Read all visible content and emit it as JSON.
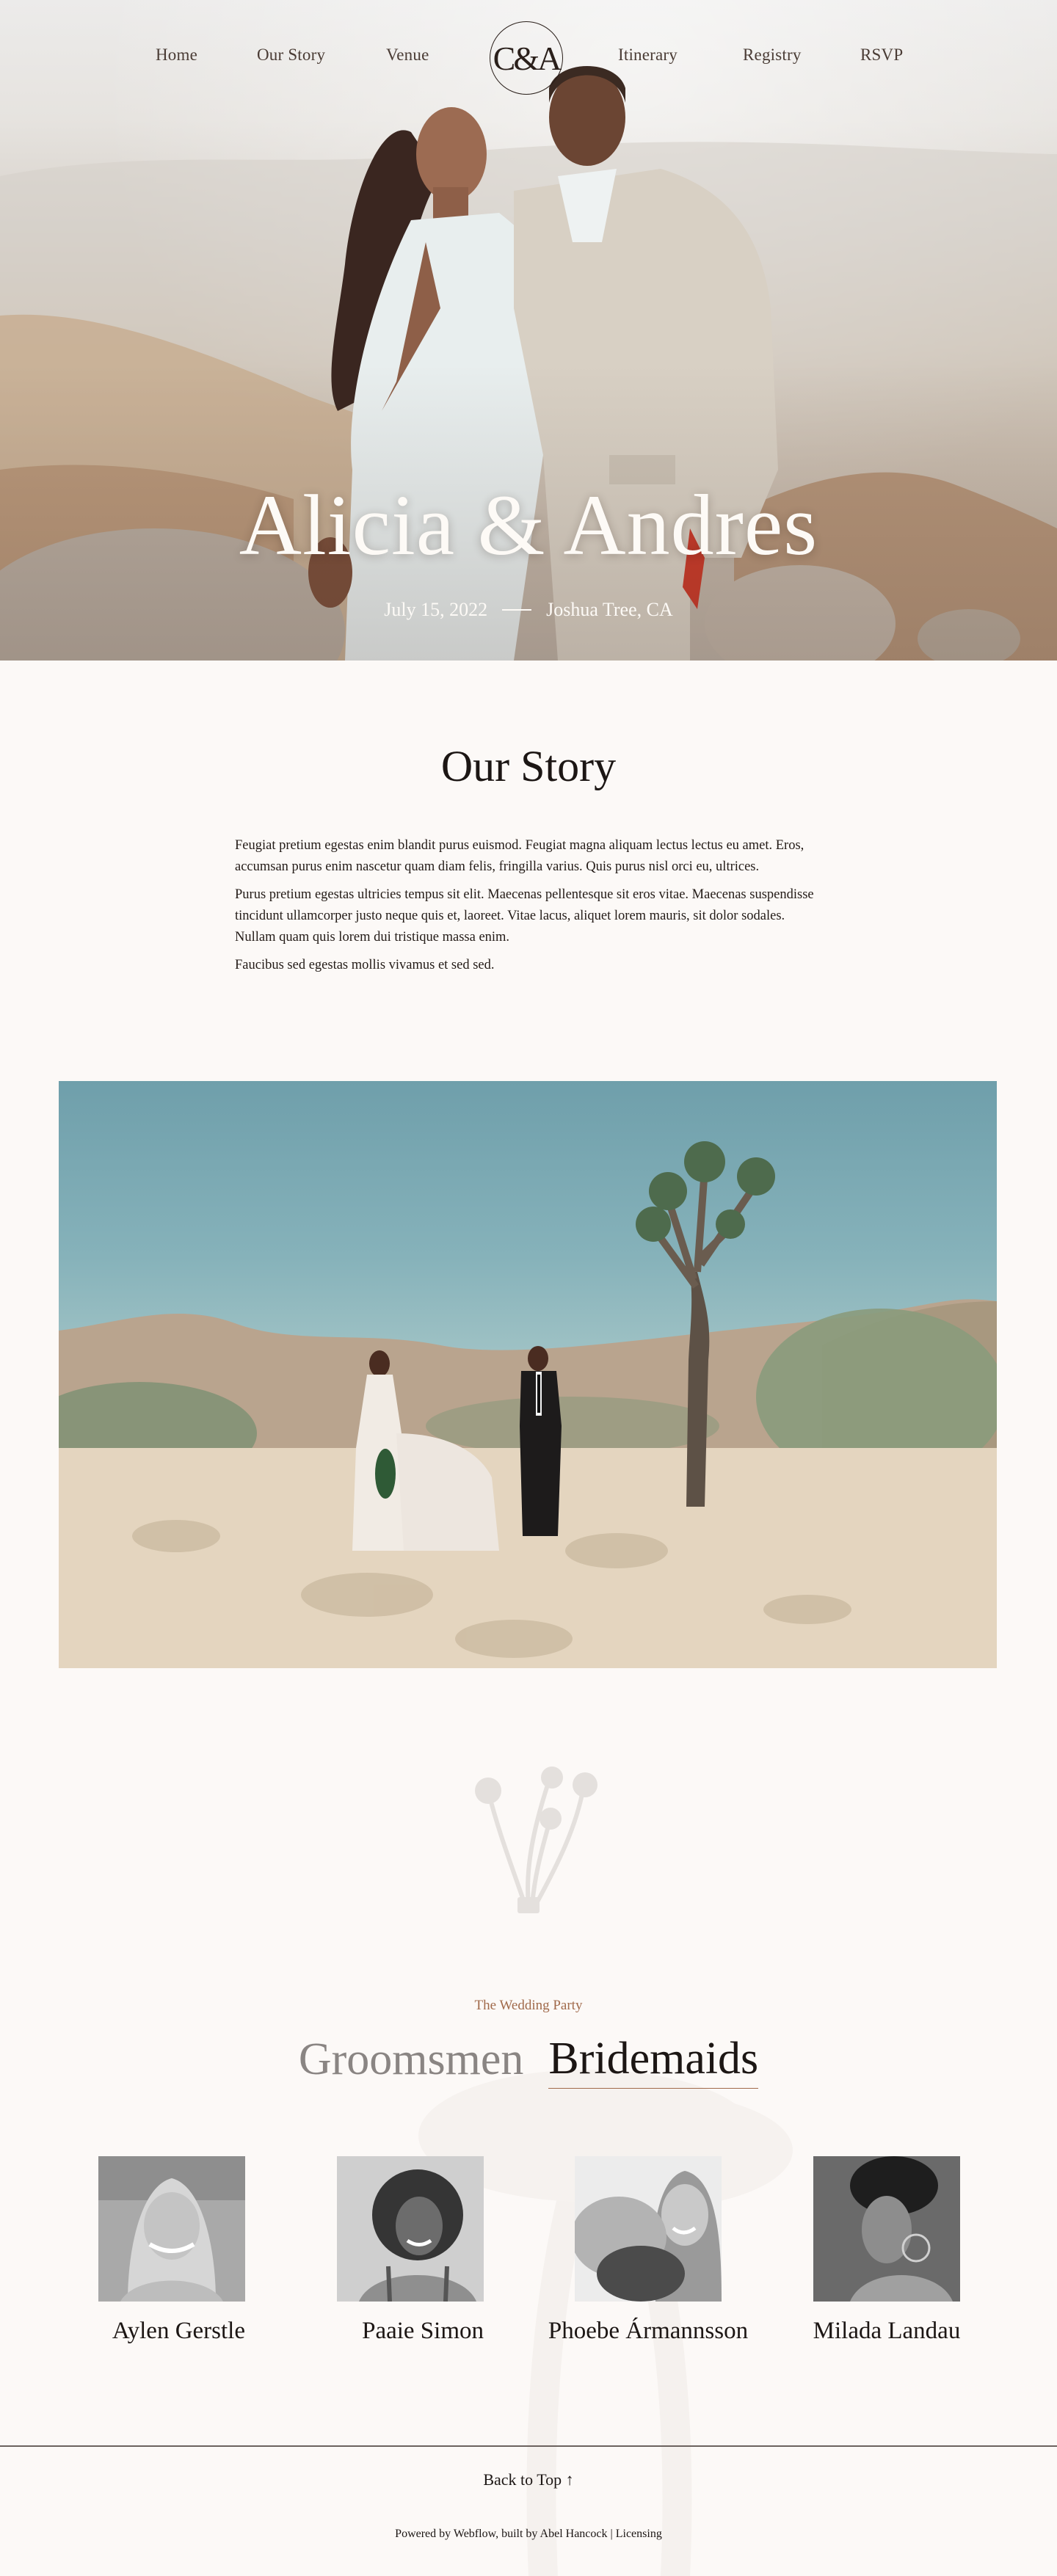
{
  "nav": {
    "left": [
      {
        "label": "Home"
      },
      {
        "label": "Our Story"
      },
      {
        "label": "Venue"
      }
    ],
    "logo": "C&A",
    "right": [
      {
        "label": "Itinerary"
      },
      {
        "label": "Registry"
      },
      {
        "label": "RSVP"
      }
    ]
  },
  "hero": {
    "title": "Alicia & Andres",
    "date": "July 15, 2022",
    "location": "Joshua Tree, CA"
  },
  "story": {
    "title": "Our Story",
    "paragraphs": [
      "Feugiat pretium egestas enim blandit purus euismod. Feugiat magna aliquam lectus lectus eu amet. Eros, accumsan purus enim nascetur quam diam felis, fringilla varius. Quis purus nisl orci eu, ultrices.",
      "Purus pretium egestas ultricies tempus sit elit. Maecenas pellentesque sit eros vitae. Maecenas suspendisse tincidunt ullamcorper justo neque quis et, laoreet. Vitae lacus, aliquet lorem mauris, sit dolor sodales. Nullam quam quis lorem dui tristique massa enim.",
      "Faucibus sed egestas mollis vivamus et sed sed."
    ]
  },
  "party": {
    "eyebrow": "The Wedding Party",
    "tabs": [
      {
        "label": "Groomsmen",
        "active": false
      },
      {
        "label": "Bridemaids",
        "active": true
      }
    ],
    "members": [
      {
        "name": "Aylen Gerstle"
      },
      {
        "name": "Paaie Simon"
      },
      {
        "name": "Phoebe Ármannsson"
      },
      {
        "name": "Milada Landau"
      }
    ]
  },
  "footer": {
    "back_to_top": "Back to Top ↑",
    "powered_prefix": "Powered by ",
    "webflow": "Webflow",
    "built_by": ", built by ",
    "author": "Abel Hancock",
    "separator": " | ",
    "licensing": "Licensing"
  },
  "colors": {
    "background": "#fcf9f7",
    "text": "#1c1614",
    "accent": "#a16a4b",
    "inactive_tab": "#8a8583"
  }
}
